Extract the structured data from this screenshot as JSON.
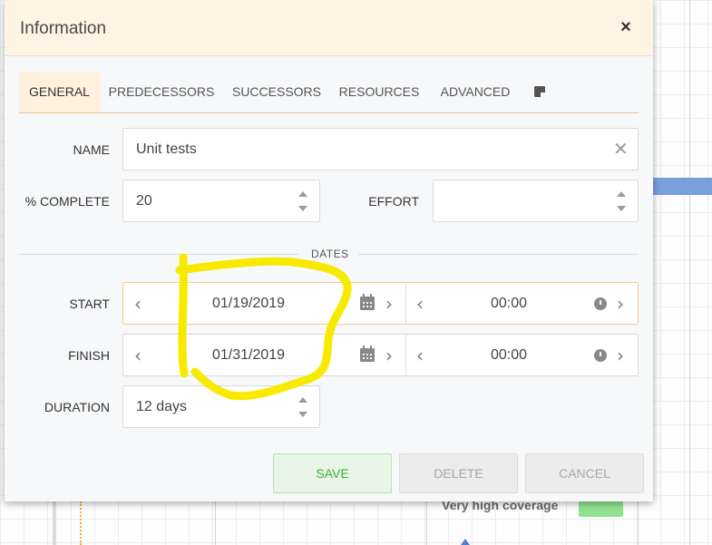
{
  "background": {
    "row_label": "Very high coverage"
  },
  "dialog": {
    "title": "Information",
    "close_glyph": "×"
  },
  "tabs": [
    {
      "label": "GENERAL",
      "active": true
    },
    {
      "label": "PREDECESSORS",
      "active": false
    },
    {
      "label": "SUCCESSORS",
      "active": false
    },
    {
      "label": "RESOURCES",
      "active": false
    },
    {
      "label": "ADVANCED",
      "active": false
    }
  ],
  "notes_tab": {
    "icon": "note-icon"
  },
  "fields": {
    "name": {
      "label": "NAME",
      "value": "Unit tests"
    },
    "percent_complete": {
      "label": "% COMPLETE",
      "value": "20"
    },
    "effort": {
      "label": "EFFORT",
      "value": ""
    },
    "dates_section": "DATES",
    "start": {
      "label": "START",
      "date": "01/19/2019",
      "time": "00:00"
    },
    "finish": {
      "label": "FINISH",
      "date": "01/31/2019",
      "time": "00:00"
    },
    "duration": {
      "label": "DURATION",
      "value": "12 days"
    }
  },
  "buttons": {
    "save": "SAVE",
    "delete": "DELETE",
    "cancel": "CANCEL"
  },
  "glyphs": {
    "clear": "✕",
    "prev": "‹",
    "next": "›"
  },
  "colors": {
    "header_bg": "#fff4e4",
    "accent": "#f0c98a",
    "save_green": "#3fae3a",
    "highlight": "#f7ea00",
    "gantt_bar": "#7a9fdd"
  }
}
